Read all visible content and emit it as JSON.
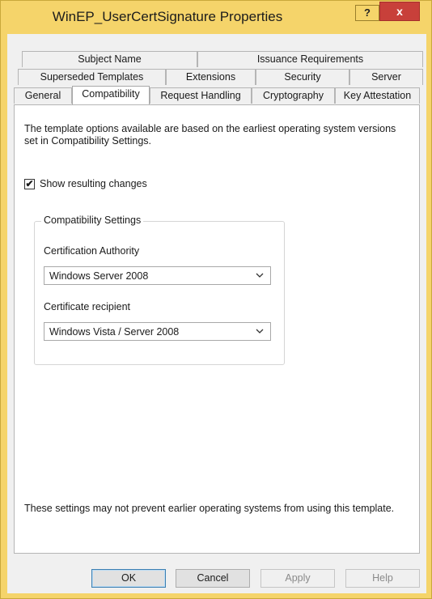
{
  "window": {
    "title": "WinEP_UserCertSignature Properties",
    "help_label": "?",
    "close_label": "x",
    "frame_color": "#f5d46a"
  },
  "tabs": {
    "row1": [
      "Subject Name",
      "Issuance Requirements"
    ],
    "row2": [
      "Superseded Templates",
      "Extensions",
      "Security",
      "Server"
    ],
    "row3": [
      "General",
      "Compatibility",
      "Request Handling",
      "Cryptography",
      "Key Attestation"
    ],
    "active": "Compatibility"
  },
  "compatibility": {
    "description": "The template options available are based on the earliest operating system versions set in Compatibility Settings.",
    "show_changes": {
      "label": "Show resulting changes",
      "checked": true,
      "mark": "✔"
    },
    "group_title": "Compatibility Settings",
    "ca": {
      "label": "Certification Authority",
      "value": "Windows Server 2008"
    },
    "recipient": {
      "label": "Certificate recipient",
      "value": "Windows Vista / Server 2008"
    },
    "note": "These settings may not prevent earlier operating systems from using this template."
  },
  "buttons": {
    "ok": "OK",
    "cancel": "Cancel",
    "apply": "Apply",
    "help": "Help"
  }
}
